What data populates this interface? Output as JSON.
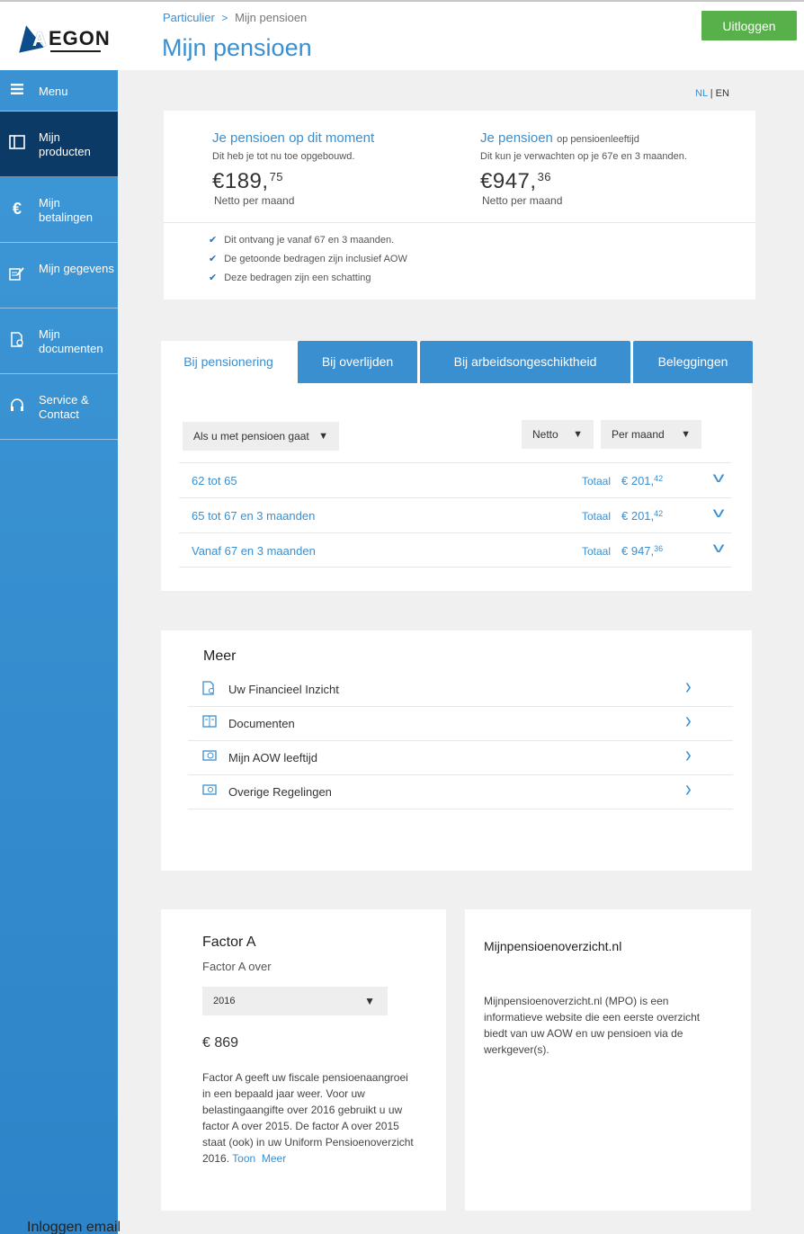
{
  "header": {
    "logo_text": "EGON",
    "logo_letter": "A",
    "breadcrumb": {
      "root": "Particulier",
      "separator": ">",
      "current": "Mijn pensioen"
    },
    "title": "Mijn pensioen",
    "logout_label": "Uitloggen"
  },
  "sidebar": {
    "items": [
      {
        "label": "Menu",
        "icon": "hamburger-icon"
      },
      {
        "label": "Mijn producten",
        "icon": "book-icon"
      },
      {
        "label": "Mijn betalingen",
        "icon": "euro-icon"
      },
      {
        "label": "Mijn gegevens",
        "icon": "edit-form-icon"
      },
      {
        "label": "Mijn documenten",
        "icon": "document-icon"
      },
      {
        "label": "Service & Contact",
        "icon": "headset-icon"
      }
    ]
  },
  "lang": {
    "nl": "NL",
    "sep": "|",
    "en": "EN"
  },
  "summary": {
    "left": {
      "heading": "Je pensioen op dit moment",
      "sub": "Dit heb je tot nu toe opgebouwd.",
      "amount_main": "€189,",
      "amount_cents": "75",
      "note": "Netto per maand"
    },
    "right": {
      "heading": "Je pensioen",
      "heading_suffix": "op pensioenleeftijd",
      "sub": "Dit kun je verwachten op je 67e en 3 maanden.",
      "amount_main": "€947,",
      "amount_cents": "36",
      "note": "Netto per maand"
    },
    "checks": [
      "Dit ontvang je vanaf 67 en 3 maanden.",
      "De getoonde bedragen zijn inclusief AOW",
      "Deze bedragen zijn een schatting"
    ]
  },
  "tabs": [
    {
      "label": "Bij pensionering"
    },
    {
      "label": "Bij overlijden"
    },
    {
      "label": "Bij arbeidsongeschiktheid"
    },
    {
      "label": "Beleggingen"
    }
  ],
  "filters": {
    "scenario": "Als u met pensioen gaat",
    "netto": "Netto",
    "period": "Per maand"
  },
  "periods": [
    {
      "label": "62 tot 65",
      "total_label": "Totaal",
      "amount_main": "€ 201,",
      "amount_cents": "42"
    },
    {
      "label": "65 tot  67 en 3 maanden",
      "total_label": "Totaal",
      "amount_main": "€ 201,",
      "amount_cents": "42"
    },
    {
      "label": "Vanaf  67 en 3 maanden",
      "total_label": "Totaal",
      "amount_main": "€ 947,",
      "amount_cents": "36"
    }
  ],
  "meer": {
    "title": "Meer",
    "items": [
      {
        "label": "Uw Financieel Inzicht",
        "icon": "financial-doc-icon"
      },
      {
        "label": "Documenten",
        "icon": "open-book-icon"
      },
      {
        "label": "Mijn AOW leeftijd",
        "icon": "clock-card-icon"
      },
      {
        "label": "Overige Regelingen",
        "icon": "card-icon"
      }
    ]
  },
  "factor": {
    "title": "Factor A",
    "over_label": "Factor A over",
    "year": "2016",
    "value": "€ 869",
    "text": "Factor A geeft uw fiscale pensioenaangroei in een bepaald jaar weer.  Voor uw belastingaangifte over 2016 gebruikt u uw factor A over 2015. De factor A over 2015 staat (ook) in uw Uniform Pensioenoverzicht 2016.",
    "link1": "Toon",
    "link2": "Meer"
  },
  "mpo": {
    "title": "Mijnpensioenoverzicht.nl",
    "text": " Mijnpensioenoverzicht.nl (MPO) is een informatieve website die een eerste overzicht biedt van uw AOW en uw pensioen via de werkgever(s)."
  },
  "footer_fragment": "Inloggen email"
}
